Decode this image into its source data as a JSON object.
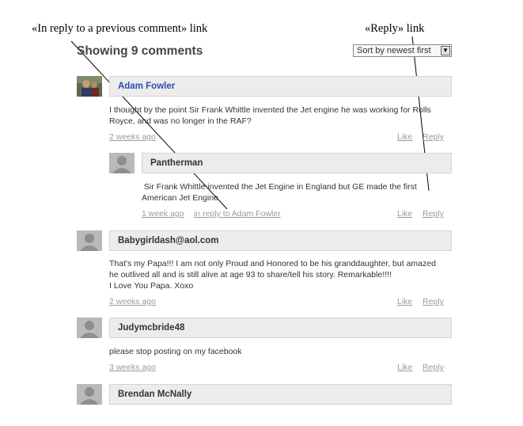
{
  "annotations": {
    "left": "«In reply to a previous  comment» link",
    "right": "«Reply» link"
  },
  "header": {
    "title": "Showing 9 comments",
    "sort_label": "Sort by newest first",
    "sort_arrow_icon": "chevron-down-icon"
  },
  "comments": [
    {
      "author": "Adam Fowler",
      "text_lines": [
        "I thought by the point Sir Frank Whittle invented the Jet engine he was working for Rolls",
        "Royce, and was no longer in the RAF?"
      ],
      "time": "2 weeks ago",
      "like": "Like",
      "reply": "Reply"
    },
    {
      "author": "Pantherman",
      "text_lines": [
        " Sir Frank Whittle invented the Jet Engine in England but GE made the first",
        "American Jet Engine"
      ],
      "time": "1 week ago",
      "in_reply": "in reply to Adam Fowler",
      "like": "Like",
      "reply": "Reply"
    },
    {
      "author": "Babygirldash@aol.com",
      "text_lines": [
        "That's my Papa!!! I am not only Proud and Honored to be his granddaughter, but amazed",
        "he outlived all and is still alive at age 93 to share/tell his story. Remarkable!!!!",
        "I Love You Papa. Xoxo"
      ],
      "time": "2 weeks ago",
      "like": "Like",
      "reply": "Reply"
    },
    {
      "author": "Judymcbride48",
      "text_lines": [
        "please stop posting on my facebook"
      ],
      "time": "3 weeks ago",
      "like": "Like",
      "reply": "Reply"
    },
    {
      "author": "Brendan McNally"
    }
  ]
}
